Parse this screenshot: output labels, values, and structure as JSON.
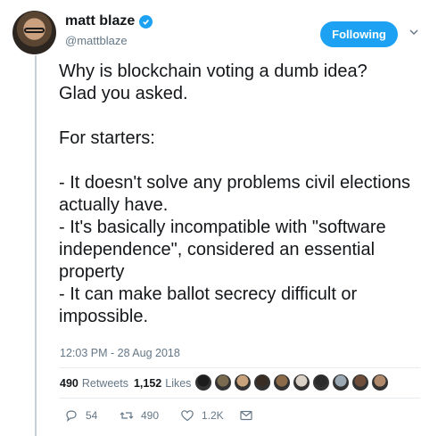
{
  "author": {
    "display_name": "matt blaze",
    "handle": "@mattblaze",
    "verified": true
  },
  "follow_button": {
    "label": "Following"
  },
  "menu": {
    "icon": "chevron-down-icon"
  },
  "tweet": {
    "text": "Why is blockchain voting a dumb idea?\nGlad you asked.\n\nFor starters:\n\n- It doesn't solve any problems civil elections actually have.\n- It's basically incompatible with \"software independence\", considered an essential property\n- It can make ballot secrecy difficult or impossible.",
    "timestamp": "12:03 PM - 28 Aug 2018"
  },
  "stats": {
    "retweets_count": "490",
    "retweets_label": "Retweets",
    "likes_count": "1,152",
    "likes_label": "Likes"
  },
  "likers": [
    "#1c1c1c",
    "#7a6a4f",
    "#c8a27a",
    "#3a2d24",
    "#8b6b4a",
    "#d9d0c6",
    "#2b2b2b",
    "#9aa8b4",
    "#6e4d3a",
    "#b08a6a"
  ],
  "actions": {
    "replies": "54",
    "retweets": "490",
    "likes": "1.2K"
  },
  "colors": {
    "brand": "#1da1f2",
    "text": "#14171a",
    "secondary": "#657786",
    "thread_line": "#c4cfd6"
  }
}
